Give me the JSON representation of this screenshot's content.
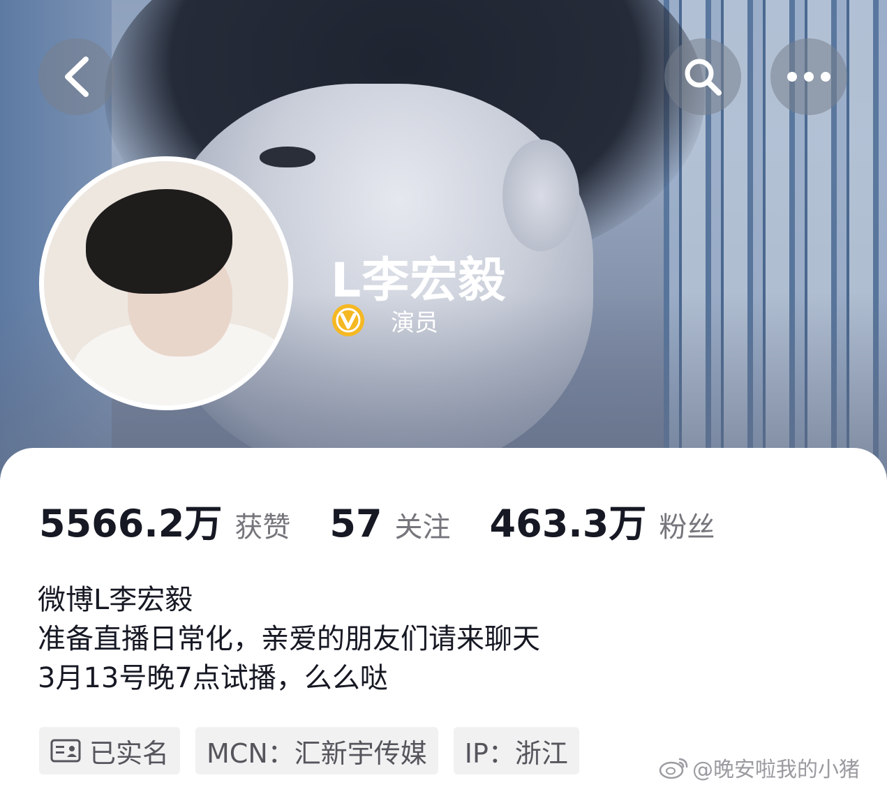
{
  "header": {
    "back_icon": "chevron-left-icon",
    "search_icon": "search-icon",
    "more_icon": "more-horizontal-icon"
  },
  "profile": {
    "name": "L李宏毅",
    "verify_badge_icon": "verified-v-badge-icon",
    "verify_label": "演员"
  },
  "stats": [
    {
      "value": "5566.2万",
      "label": "获赞"
    },
    {
      "value": "57",
      "label": "关注"
    },
    {
      "value": "463.3万",
      "label": "粉丝"
    }
  ],
  "bio": [
    "微博L李宏毅",
    "准备直播日常化，亲爱的朋友们请来聊天",
    "3月13号晚7点试播，么么哒"
  ],
  "tags": [
    {
      "label": "已实名",
      "icon": "id-card-icon"
    },
    {
      "label": "MCN：汇新宇传媒"
    },
    {
      "label": "IP：浙江"
    }
  ],
  "watermark": {
    "icon": "weibo-icon",
    "text": "@晚安啦我的小猪"
  },
  "colors": {
    "badge_yellow": "#f5b823",
    "text_primary": "#161823",
    "text_secondary": "#75757c",
    "tag_bg": "#f1f1f2"
  }
}
